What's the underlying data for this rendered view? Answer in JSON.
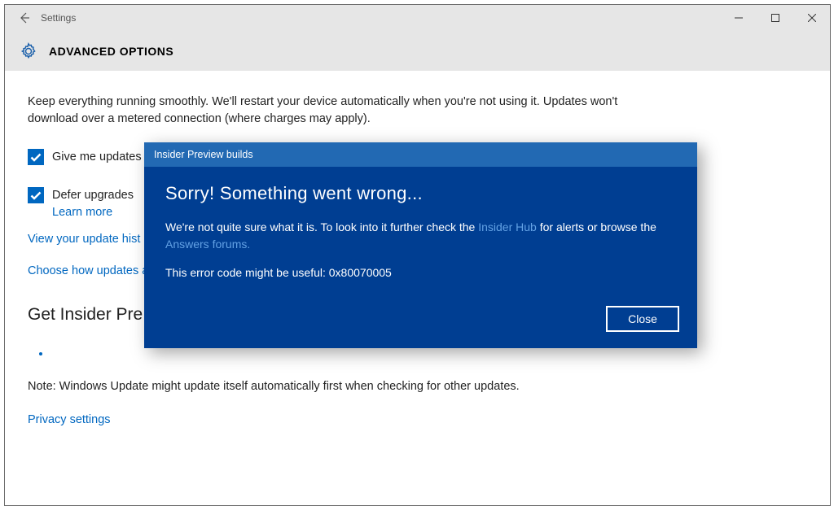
{
  "window": {
    "app_title": "Settings"
  },
  "header": {
    "page_title": "ADVANCED OPTIONS"
  },
  "content": {
    "intro": "Keep everything running smoothly. We'll restart your device automatically when you're not using it. Updates won't download over a metered connection (where charges may apply).",
    "check1_label": "Give me updates f",
    "check2_label": "Defer upgrades",
    "learn_more": "Learn more",
    "link_history": "View your update hist",
    "link_choose": "Choose how updates a",
    "section_head": "Get Insider Pre",
    "note": "Note: Windows Update might update itself automatically first when checking for other updates.",
    "privacy": "Privacy settings"
  },
  "dialog": {
    "title": "Insider Preview builds",
    "heading": "Sorry! Something went wrong...",
    "body_pre": "We're not quite sure what it is. To look into it further check the ",
    "link1": "Insider Hub",
    "body_mid": " for alerts or browse the ",
    "link2": "Answers forums.",
    "error_line": "This error code might be useful: 0x80070005",
    "close": "Close"
  }
}
